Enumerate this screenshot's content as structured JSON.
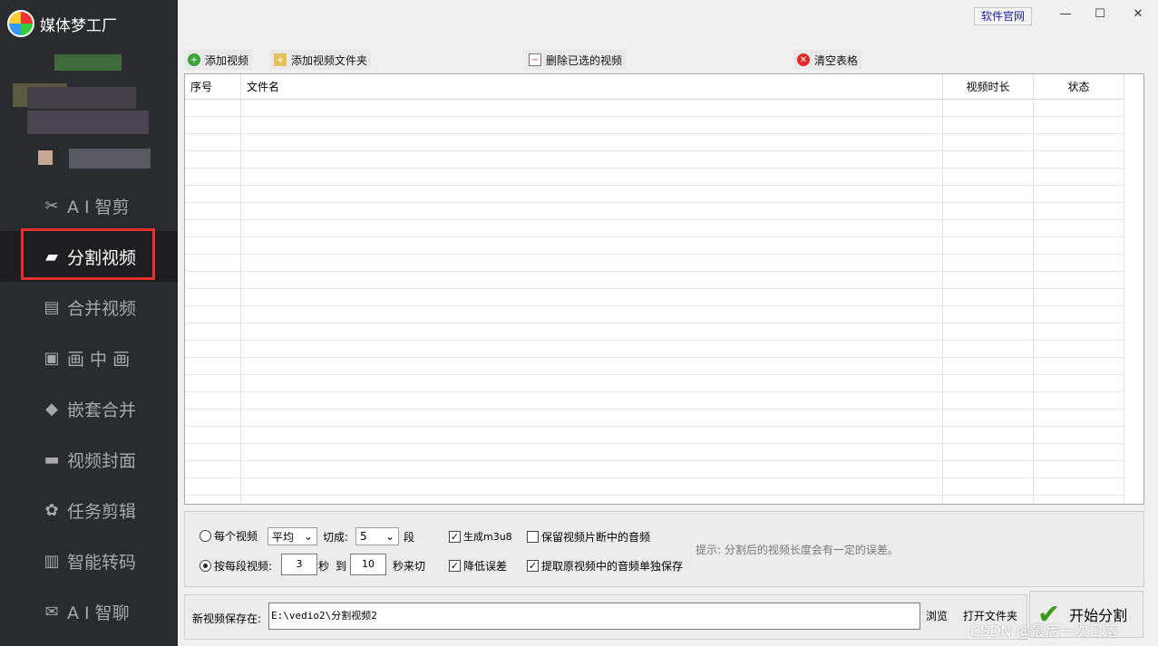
{
  "app": {
    "name": "媒体梦工厂"
  },
  "sidebar": {
    "items": [
      {
        "label": "A I 智剪",
        "icon": "ai-cut-icon",
        "glyph": "✂"
      },
      {
        "label": "分割视频",
        "icon": "split-video-icon",
        "glyph": "▰"
      },
      {
        "label": "合并视频",
        "icon": "merge-video-icon",
        "glyph": "▤"
      },
      {
        "label": "画 中 画",
        "icon": "picture-in-picture-icon",
        "glyph": "▣"
      },
      {
        "label": "嵌套合并",
        "icon": "nested-merge-icon",
        "glyph": "◆"
      },
      {
        "label": "视频封面",
        "icon": "video-cover-icon",
        "glyph": "▬"
      },
      {
        "label": "任务剪辑",
        "icon": "task-edit-icon",
        "glyph": "✿"
      },
      {
        "label": "智能转码",
        "icon": "transcode-icon",
        "glyph": "▥"
      },
      {
        "label": "A I 智聊",
        "icon": "ai-chat-icon",
        "glyph": "✉"
      }
    ],
    "active_index": 1
  },
  "titlebar": {
    "site_link": "软件官网",
    "minimize": "—",
    "maximize": "☐",
    "close": "✕"
  },
  "toolbar": {
    "add_video": "添加视频",
    "add_folder": "添加视频文件夹",
    "delete_selected": "删除已选的视频",
    "clear_table": "清空表格"
  },
  "table": {
    "columns": [
      "序号",
      "文件名",
      "视频时长",
      "状态"
    ],
    "rows": []
  },
  "options": {
    "per_video_label": "每个视频",
    "mode_value": "平均",
    "cut_into_label": "切成:",
    "segments_value": "5",
    "segment_unit": "段",
    "gen_m3u8": "生成m3u8",
    "keep_audio": "保留视频片断中的音频",
    "per_segment_label": "按每段视频:",
    "min_seconds": "3",
    "sec_label": "秒",
    "to_label": "到",
    "max_seconds": "10",
    "random_cut_label": "秒来切",
    "reduce_error": "降低误差",
    "extract_audio": "提取原视频中的音频单独保存",
    "hint": "提示: 分割后的视频长度会有一定的误差。",
    "state": {
      "per_video_selected": false,
      "per_segment_selected": true,
      "gen_m3u8": true,
      "keep_audio": false,
      "reduce_error": true,
      "extract_audio": true
    }
  },
  "save": {
    "label": "新视频保存在:",
    "path": "E:\\vedio2\\分割视频2",
    "browse": "浏览",
    "open_folder": "打开文件夹",
    "start": "开始分割"
  },
  "watermark": "CSDN @最后一次日落",
  "colors": {
    "sidebar_bg": "#2a2b2f",
    "active_border": "#e3302f",
    "start_check": "#3a9a1a"
  }
}
